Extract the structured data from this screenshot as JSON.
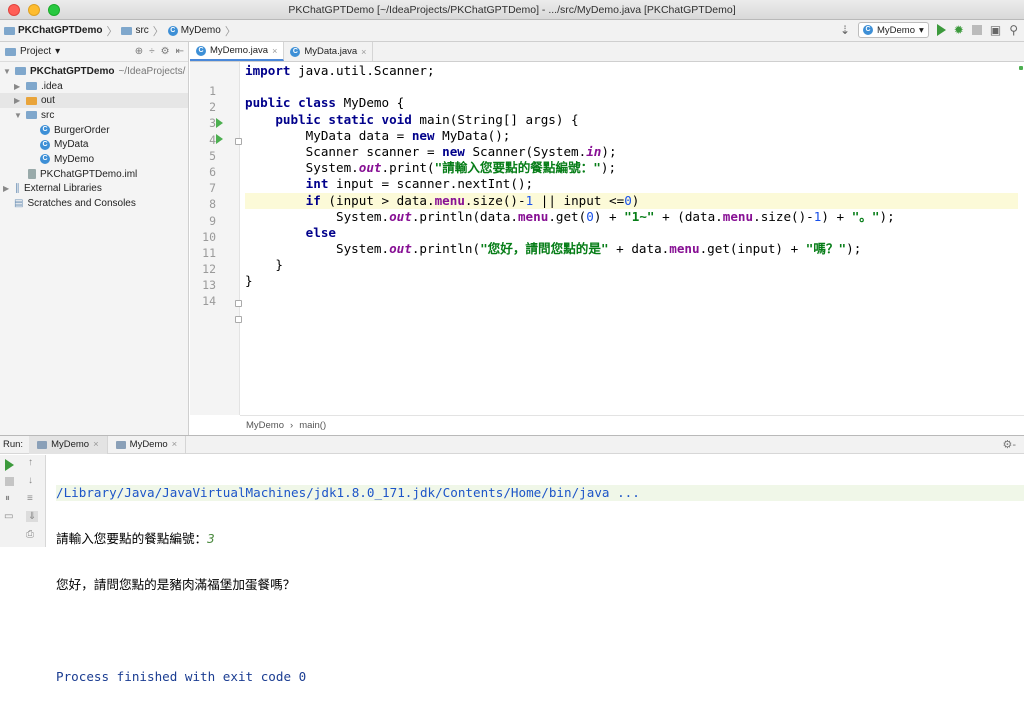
{
  "window": {
    "title": "PKChatGPTDemo [~/IdeaProjects/PKChatGPTDemo] - .../src/MyDemo.java [PKChatGPTDemo]"
  },
  "nav": {
    "project": "PKChatGPTDemo",
    "src": "src",
    "file": "MyDemo",
    "run_config": "MyDemo"
  },
  "sidebar": {
    "title": "Project",
    "root_name": "PKChatGPTDemo",
    "root_path": "~/IdeaProjects/",
    "items": [
      {
        "label": ".idea"
      },
      {
        "label": "out"
      },
      {
        "label": "src"
      },
      {
        "label": "BurgerOrder"
      },
      {
        "label": "MyData"
      },
      {
        "label": "MyDemo"
      },
      {
        "label": "PKChatGPTDemo.iml"
      },
      {
        "label": "External Libraries"
      },
      {
        "label": "Scratches and Consoles"
      }
    ]
  },
  "tabs": [
    {
      "label": "MyDemo.java"
    },
    {
      "label": "MyData.java"
    }
  ],
  "editor": {
    "line_numbers": [
      "1",
      "2",
      "3",
      "4",
      "5",
      "6",
      "7",
      "8",
      "9",
      "10",
      "11",
      "12",
      "13",
      "14"
    ],
    "breadcrumb": [
      "MyDemo",
      "main()"
    ]
  },
  "code": [
    [
      {
        "t": "import",
        "k": "kw"
      },
      {
        "t": " java.util.Scanner;"
      }
    ],
    [],
    [
      {
        "t": "public class",
        "k": "kw"
      },
      {
        "t": " MyDemo {"
      }
    ],
    [
      {
        "t": "    "
      },
      {
        "t": "public static void",
        "k": "kw"
      },
      {
        "t": " main(String[] args) {"
      }
    ],
    [
      {
        "t": "        MyData data = "
      },
      {
        "t": "new",
        "k": "kw"
      },
      {
        "t": " MyData();"
      }
    ],
    [
      {
        "t": "        Scanner scanner = "
      },
      {
        "t": "new",
        "k": "kw"
      },
      {
        "t": " Scanner(System."
      },
      {
        "t": "in",
        "k": "sfld"
      },
      {
        "t": ");"
      }
    ],
    [
      {
        "t": "        System."
      },
      {
        "t": "out",
        "k": "sfld"
      },
      {
        "t": ".print("
      },
      {
        "t": "\"請輸入您要點的餐點編號：\"",
        "k": "str"
      },
      {
        "t": ");"
      }
    ],
    [
      {
        "t": "        "
      },
      {
        "t": "int",
        "k": "kw"
      },
      {
        "t": " input = scanner.nextInt();"
      }
    ],
    [
      {
        "t": "        "
      },
      {
        "t": "if",
        "k": "kw"
      },
      {
        "t": " (input > data."
      },
      {
        "t": "menu",
        "k": "fld"
      },
      {
        "t": ".size()-"
      },
      {
        "t": "1",
        "k": "num"
      },
      {
        "t": " || input <="
      },
      {
        "t": "0",
        "k": "num"
      },
      {
        "t": ")"
      }
    ],
    [
      {
        "t": "            System."
      },
      {
        "t": "out",
        "k": "sfld"
      },
      {
        "t": ".println(data."
      },
      {
        "t": "menu",
        "k": "fld"
      },
      {
        "t": ".get("
      },
      {
        "t": "0",
        "k": "num"
      },
      {
        "t": ") + "
      },
      {
        "t": "\"1~\"",
        "k": "str"
      },
      {
        "t": " + (data."
      },
      {
        "t": "menu",
        "k": "fld"
      },
      {
        "t": ".size()-"
      },
      {
        "t": "1",
        "k": "num"
      },
      {
        "t": ") + "
      },
      {
        "t": "\"。\"",
        "k": "str"
      },
      {
        "t": ");"
      }
    ],
    [
      {
        "t": "        "
      },
      {
        "t": "else",
        "k": "kw"
      }
    ],
    [
      {
        "t": "            System."
      },
      {
        "t": "out",
        "k": "sfld"
      },
      {
        "t": ".println("
      },
      {
        "t": "\"您好，請問您點的是\"",
        "k": "str"
      },
      {
        "t": " + data."
      },
      {
        "t": "menu",
        "k": "fld"
      },
      {
        "t": ".get(input) + "
      },
      {
        "t": "\"嗎？\"",
        "k": "str"
      },
      {
        "t": ");"
      }
    ],
    [
      {
        "t": "    }"
      }
    ],
    [
      {
        "t": "}"
      }
    ]
  ],
  "run": {
    "label": "Run:",
    "tabs": [
      {
        "label": "MyDemo"
      },
      {
        "label": "MyDemo"
      }
    ],
    "command": "/Library/Java/JavaVirtualMachines/jdk1.8.0_171.jdk/Contents/Home/bin/java ...",
    "prompt": "請輸入您要點的餐點編號：",
    "input_value": "3",
    "reply": "您好，請問您點的是豬肉滿福堡加蛋餐嗎？",
    "exit": "Process finished with exit code 0"
  }
}
